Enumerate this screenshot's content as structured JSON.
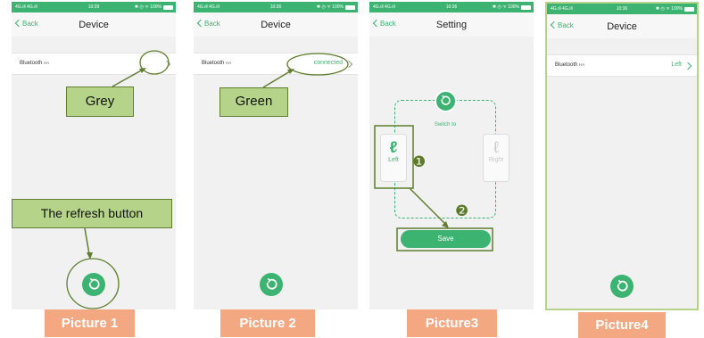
{
  "status": {
    "carrier": "4G.ıll 4G.ıll",
    "time": "10:39",
    "time2": "10:36",
    "icons": "✱ ◷ ᯤ 100%"
  },
  "nav": {
    "back": "Back",
    "title_device": "Device",
    "title_setting": "Setting"
  },
  "row": {
    "label": "Bluetooth",
    "sub": "HA",
    "connected": "connected",
    "left": "Left"
  },
  "setting": {
    "switch_to": "Switch to",
    "left": "Left",
    "right": "Right",
    "save": "Save",
    "step1": "❶",
    "step2": "❷"
  },
  "callouts": {
    "grey": "Grey",
    "green": "Green",
    "refresh": "The refresh button"
  },
  "captions": {
    "p1": "Picture 1",
    "p2": "Picture 2",
    "p3": "Picture3",
    "p4": "Picture4"
  },
  "colors": {
    "accent": "#3cb371",
    "callout_fill": "#b5d48a",
    "callout_border": "#5f7e2f",
    "caption_bg": "#f4a882"
  }
}
